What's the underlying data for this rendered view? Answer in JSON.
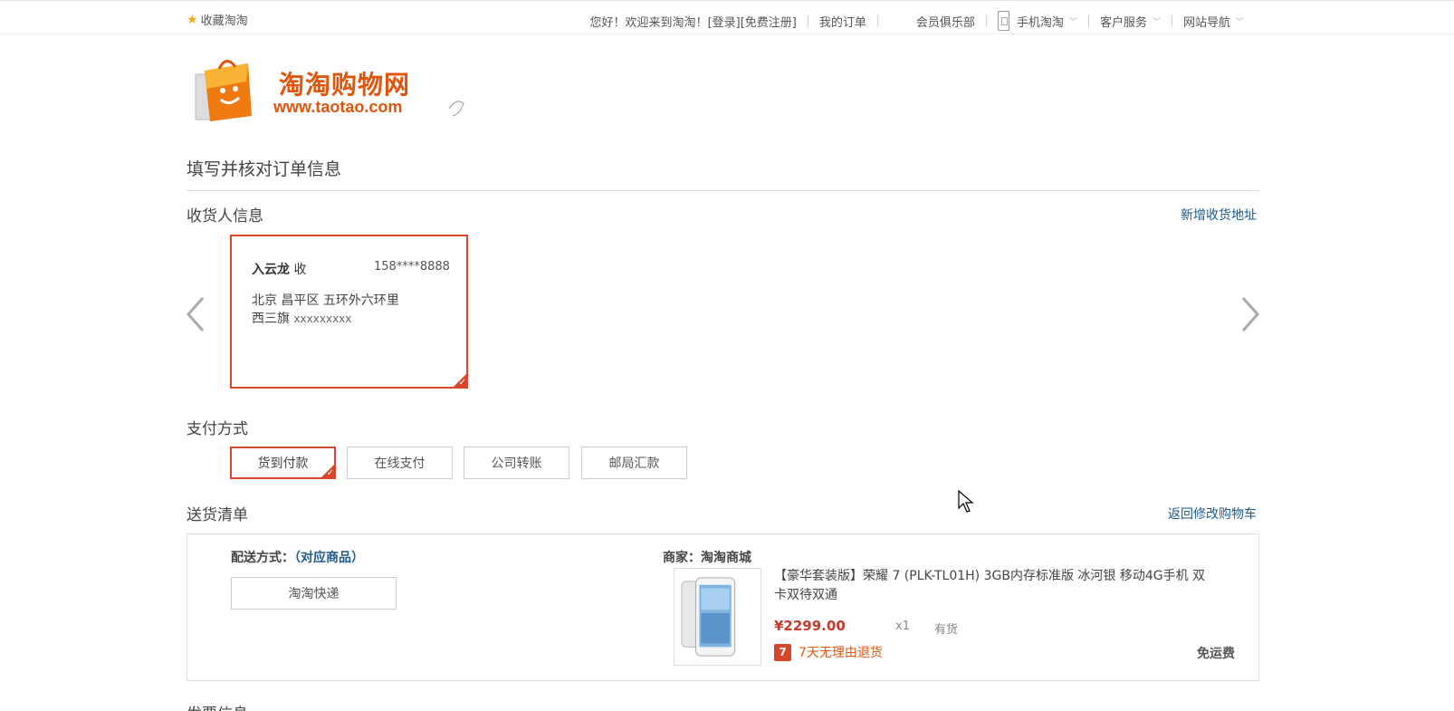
{
  "topbar": {
    "favorite": "收藏淘淘",
    "welcome": "您好！欢迎来到淘淘！",
    "login": "[登录]",
    "register": "[免费注册]",
    "my_orders": "我的订单",
    "member_club": "会员俱乐部",
    "mobile": "手机淘淘",
    "customer_service": "客户服务",
    "site_nav": "网站导航"
  },
  "logo": {
    "cn": "淘淘购物网",
    "en": "www.taotao.com"
  },
  "page": {
    "title": "填写并核对订单信息"
  },
  "consignee": {
    "section_title": "收货人信息",
    "add_address": "新增收货地址",
    "name": "入云龙",
    "name_suffix": "收",
    "phone": "158****8888",
    "address_line1": "北京 昌平区 五环外六环里",
    "address_line2_prefix": "西三旗",
    "address_detail": "xxxxxxxxx"
  },
  "payment": {
    "section_title": "支付方式",
    "options": [
      "货到付款",
      "在线支付",
      "公司转账",
      "邮局汇款"
    ],
    "selected": "货到付款"
  },
  "delivery": {
    "section_title": "送货清单",
    "back_to_cart": "返回修改购物车",
    "ship_method_label": "配送方式：",
    "ship_method_link": "（对应商品）",
    "ship_option": "淘淘快递",
    "merchant": "商家：淘淘商城",
    "product": {
      "title": "【豪华套装版】荣耀 7 (PLK-TL01H) 3GB内存标准版 冰河银 移动4G手机 双卡双待双通",
      "price": "¥2299.00",
      "qty": "x1",
      "stock": "有货",
      "return_icon": "7",
      "return_policy": "7天无理由退货",
      "shipping_fee": "免运费"
    }
  },
  "invoice": {
    "section_title": "发票信息"
  },
  "colors": {
    "accent": "#d8462b",
    "logo": "#e2550d",
    "link": "#1d5a8e",
    "price": "#c8382a"
  }
}
